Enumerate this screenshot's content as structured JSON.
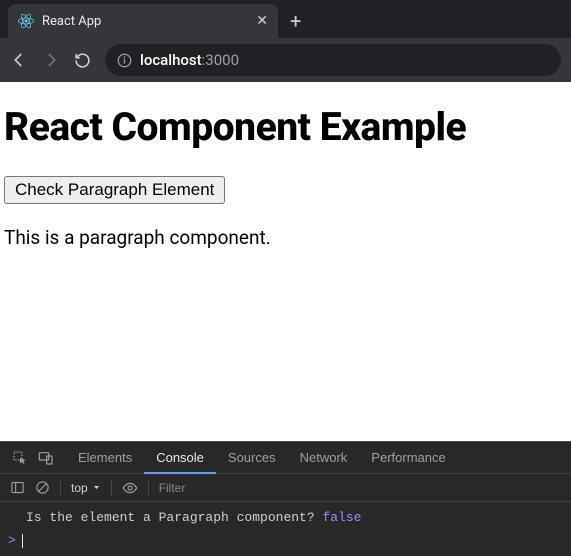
{
  "browser": {
    "tab_title": "React App",
    "url_host": "localhost",
    "url_port": ":3000"
  },
  "page": {
    "heading": "React Component Example",
    "button_label": "Check Paragraph Element",
    "paragraph": "This is a paragraph component."
  },
  "devtools": {
    "tabs": {
      "elements": "Elements",
      "console": "Console",
      "sources": "Sources",
      "network": "Network",
      "performance": "Performance"
    },
    "context_label": "top",
    "filter_placeholder": "Filter",
    "console_message": "Is the element a Paragraph component? ",
    "console_value": "false"
  }
}
